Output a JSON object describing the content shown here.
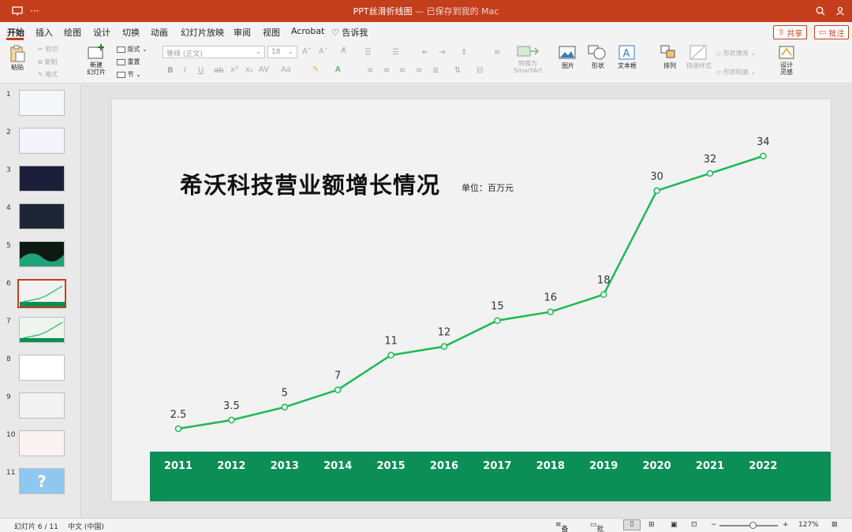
{
  "window": {
    "title": "PPT丝滑折线图",
    "save_status": "— 已保存到我的 Mac",
    "colors": {
      "accent": "#c43e1c",
      "band": "#0b8f56",
      "line": "#1db954"
    }
  },
  "tabs": [
    "开始",
    "插入",
    "绘图",
    "设计",
    "切换",
    "动画",
    "幻灯片放映",
    "审阅",
    "视图",
    "Acrobat"
  ],
  "tell_me": "告诉我",
  "share_label": "共享",
  "comment_label": "批注",
  "ribbon": {
    "paste": "粘贴",
    "cut": "剪切",
    "copy": "复制",
    "format": "格式",
    "new_slide": "新建\n幻灯片",
    "layout": "版式",
    "reset": "重置",
    "section": "节",
    "font_name": "等线 (正文)",
    "font_size": "18",
    "convert_smartart": "转换为\nSmartArt",
    "picture": "图片",
    "shape": "形状",
    "textbox": "文本框",
    "arrange": "排列",
    "quick_styles": "快速样式",
    "shape_fill": "形状填充",
    "shape_outline": "形状轮廓",
    "designer": "设计\n灵感"
  },
  "slides": [
    "1",
    "2",
    "3",
    "4",
    "5",
    "6",
    "7",
    "8",
    "9",
    "10",
    "11"
  ],
  "current_slide": 6,
  "slide": {
    "title": "希沃科技营业额增长情况",
    "unit": "单位：百万元"
  },
  "chart_data": {
    "type": "line",
    "categories": [
      "2011",
      "2012",
      "2013",
      "2014",
      "2015",
      "2016",
      "2017",
      "2018",
      "2019",
      "2020",
      "2021",
      "2022"
    ],
    "values": [
      2.5,
      3.5,
      5,
      7,
      11,
      12,
      15,
      16,
      18,
      30,
      32,
      34
    ],
    "value_labels": [
      "2.5",
      "3.5",
      "5",
      "7",
      "11",
      "12",
      "15",
      "16",
      "18",
      "30",
      "32",
      "34"
    ],
    "title": "希沃科技营业额增长情况",
    "ylabel": "单位：百万元",
    "ylim": [
      0,
      36
    ]
  },
  "status": {
    "slide_pos": "幻灯片 6 / 11",
    "language": "中文 (中国)",
    "notes": "备注",
    "comments": "批注",
    "zoom": "127%"
  }
}
